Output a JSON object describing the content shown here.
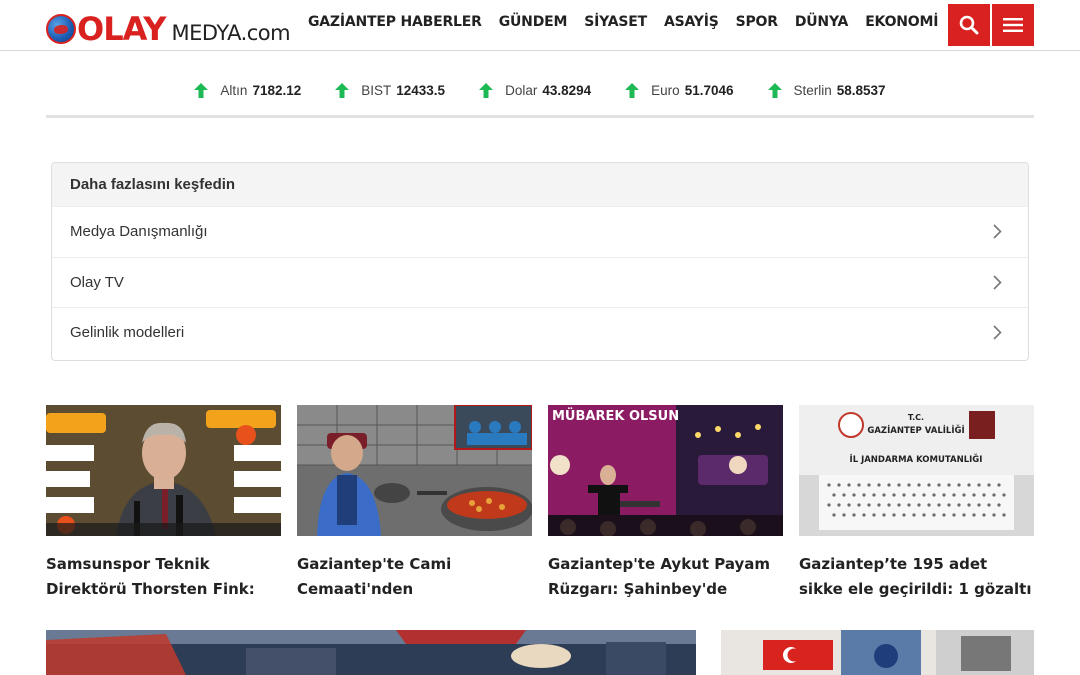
{
  "brand": {
    "logo_main": "OLAY",
    "logo_sub": "MEDYA.com"
  },
  "nav": [
    {
      "label": "GAZİANTEP HABERLER"
    },
    {
      "label": "GÜNDEM"
    },
    {
      "label": "SİYASET"
    },
    {
      "label": "ASAYİŞ"
    },
    {
      "label": "SPOR"
    },
    {
      "label": "DÜNYA"
    },
    {
      "label": "EKONOMİ"
    }
  ],
  "header_buttons": {
    "search_icon": "search-icon",
    "menu_icon": "hamburger-icon"
  },
  "ticker": [
    {
      "name": "Altın",
      "value": "7182.12",
      "trend": "up"
    },
    {
      "name": "BIST",
      "value": "12433.5",
      "trend": "up"
    },
    {
      "name": "Dolar",
      "value": "43.8294",
      "trend": "up"
    },
    {
      "name": "Euro",
      "value": "51.7046",
      "trend": "up"
    },
    {
      "name": "Sterlin",
      "value": "58.8537",
      "trend": "up"
    }
  ],
  "colors": {
    "brand_red": "#d9211f",
    "up_green": "#1db954"
  },
  "discover": {
    "heading": "Daha fazlasını keşfedin",
    "items": [
      {
        "label": "Medya Danışmanlığı"
      },
      {
        "label": "Olay TV"
      },
      {
        "label": "Gelinlik modelleri"
      }
    ]
  },
  "news": [
    {
      "title": "Samsunspor Teknik Direktörü Thorsten Fink: \"Kazanmak..."
    },
    {
      "title": "Gaziantep'te Cami Cemaati'nden Duygulandıra..."
    },
    {
      "title": "Gaziantep'te Aykut Payam Rüzgarı: Şahinbey'de Ramaz..."
    },
    {
      "title": "Gaziantep’te 195 adet sikke ele geçirildi: 1 gözaltı"
    }
  ],
  "news_image_text": {
    "card3_banner": "MÜBAREK OLSUN",
    "card4_line1": "T.C.",
    "card4_line2": "GAZİANTEP VALİLİĞİ",
    "card4_line3": "İL JANDARMA KOMUTANLIĞI"
  }
}
